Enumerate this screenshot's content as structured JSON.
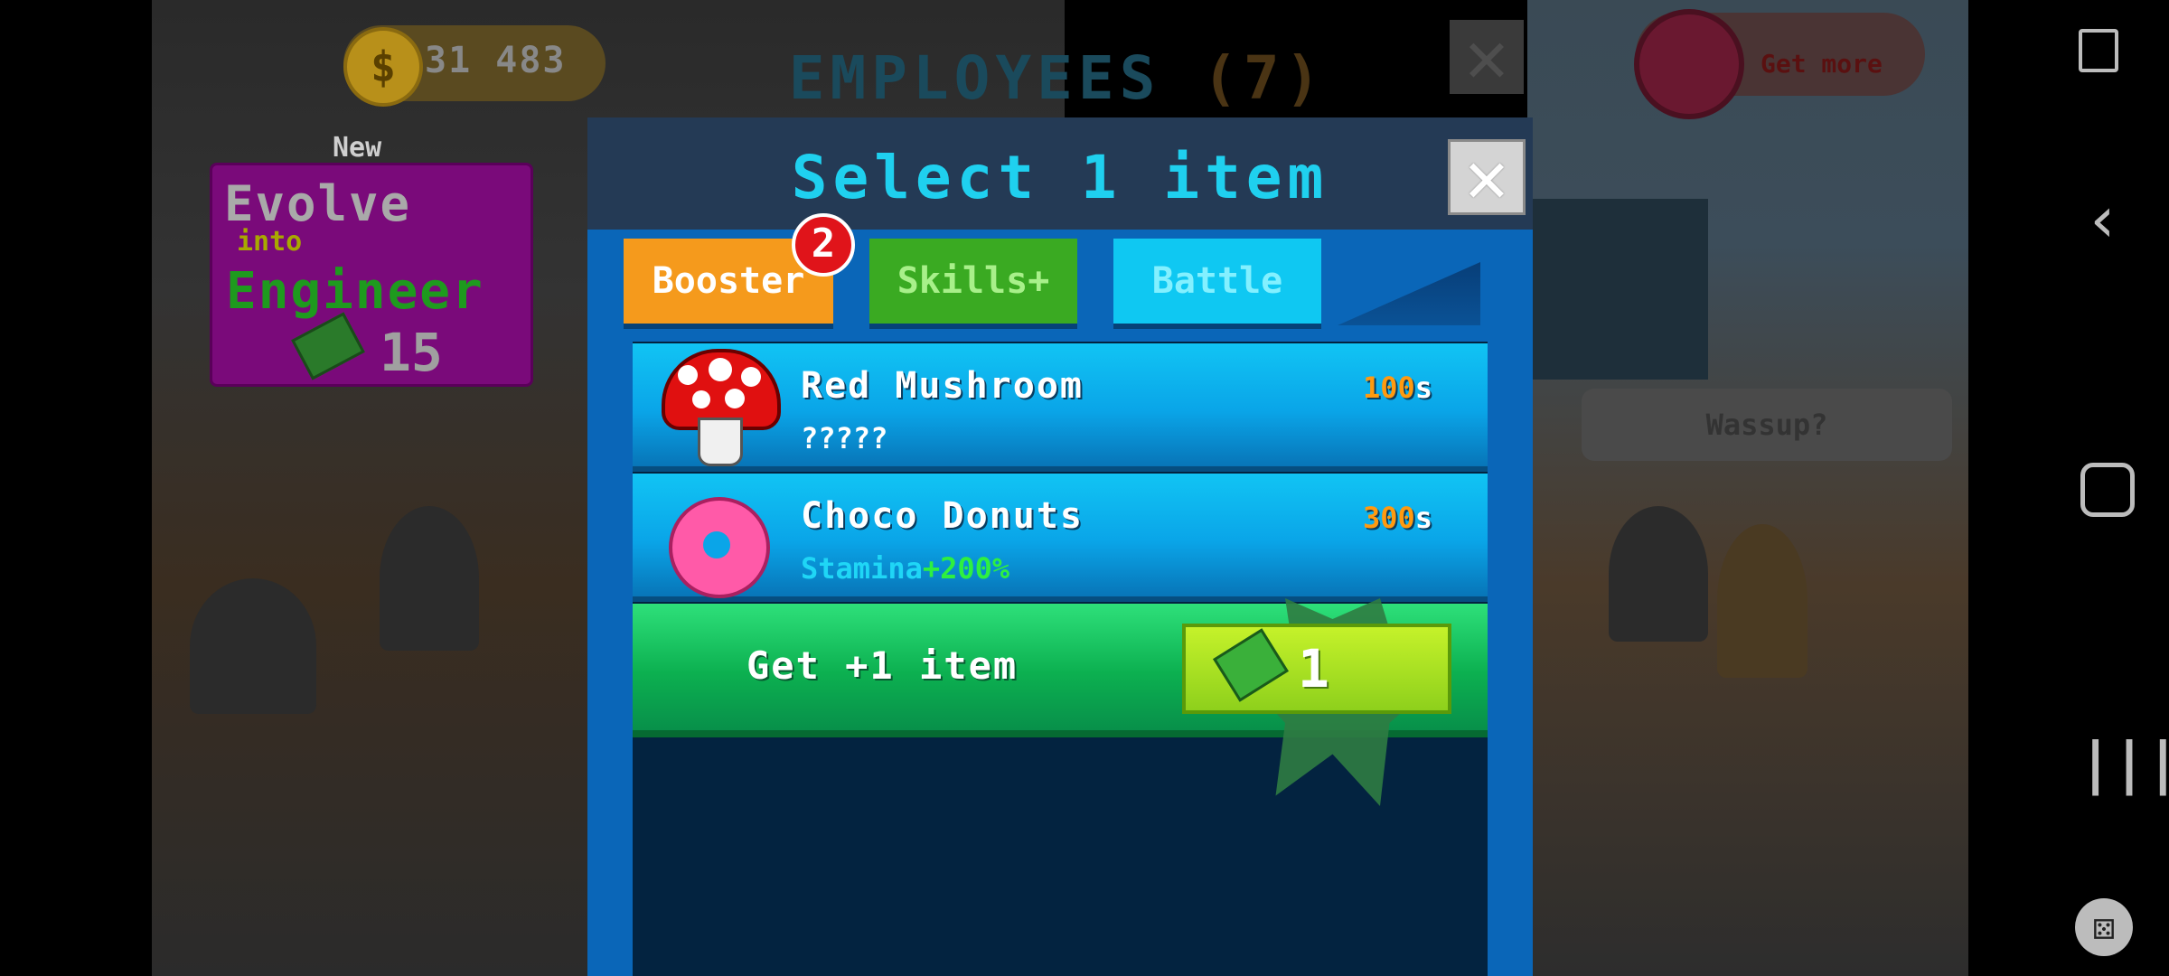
{
  "hud": {
    "coins": "31 483",
    "coin_symbol": "$",
    "get_more_label": "Get more"
  },
  "employees_title": {
    "text": "EMPLOYEES",
    "count": "(7)"
  },
  "evolve": {
    "new_label": "New",
    "line1": "Evolve",
    "line2": "into",
    "line3": "Engineer",
    "cost": "15"
  },
  "speech_bubble": "Wassup?",
  "modal": {
    "title": "Select 1 item",
    "close_glyph": "✕",
    "tabs": [
      {
        "label": "Booster",
        "badge": "2",
        "color": "#f59a1c"
      },
      {
        "label": "Skills+",
        "color": "#3aaa22"
      },
      {
        "label": "Battle",
        "color": "#0fc8f2"
      }
    ],
    "items": [
      {
        "name": "Red Mushroom",
        "desc": "?????",
        "time": "100",
        "unit": "s",
        "icon": "mushroom-icon"
      },
      {
        "name": "Choco Donuts",
        "desc_label": "Stamina",
        "desc_value": "+200%",
        "time": "300",
        "unit": "s",
        "icon": "donut-icon"
      }
    ],
    "get_more_item": {
      "label": "Get +1 item",
      "cost": "1",
      "icon": "cash-icon"
    }
  },
  "nav": {
    "back_glyph": "‹",
    "recent_glyph": "|||",
    "game_glyph": "⚄"
  }
}
